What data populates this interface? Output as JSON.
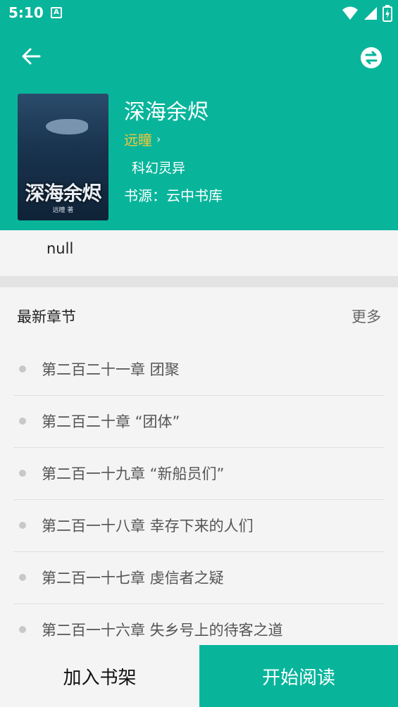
{
  "status_bar": {
    "time": "5:10",
    "indicator": "A"
  },
  "book": {
    "title": "深海余烬",
    "author": "远瞳",
    "category": "科幻灵异",
    "source": "书源：云中书库",
    "cover": {
      "art_title": "深海余烬",
      "art_author": "远瞳 著"
    }
  },
  "intro": {
    "text": "null"
  },
  "chapters": {
    "title": "最新章节",
    "more_label": "更多",
    "items": [
      "第二百二十一章 团聚",
      "第二百二十章 “团体”",
      "第二百一十九章 “新船员们”",
      "第二百一十八章 幸存下来的人们",
      "第二百一十七章 虔信者之疑",
      "第二百一十六章 失乡号上的待客之道"
    ]
  },
  "actions": {
    "add_to_shelf": "加入书架",
    "start_reading": "开始阅读"
  },
  "colors": {
    "primary": "#08b59b",
    "author": "#f5c63b",
    "background": "#f4f4f4"
  }
}
